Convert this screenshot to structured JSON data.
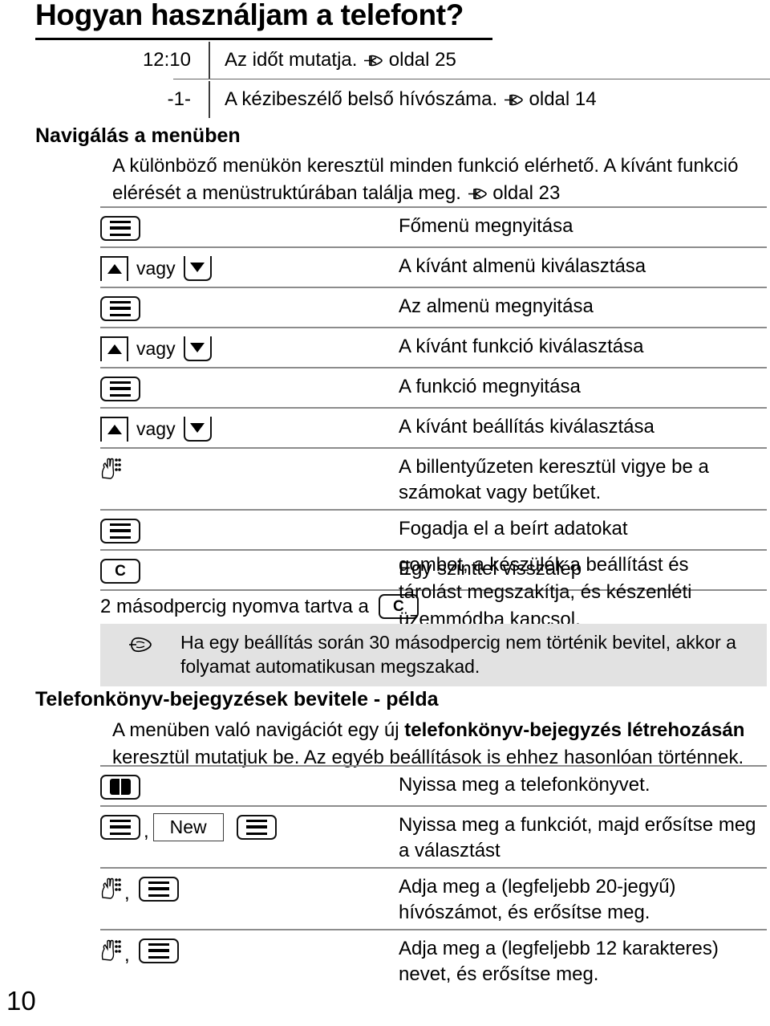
{
  "page": {
    "title": "Hogyan használjam a telefont?",
    "page_number": "10"
  },
  "display_table": {
    "rows": [
      {
        "symbol": "12:10",
        "description": "Az időt mutatja.",
        "ref_icon": "pointing-hand-icon",
        "ref": "oldal 25"
      },
      {
        "symbol": "-1-",
        "description": "A kézibeszélő belső hívószáma.",
        "ref_icon": "pointing-hand-icon",
        "ref": "oldal 14"
      }
    ]
  },
  "section_nav": {
    "heading": "Navigálás a menüben",
    "intro_part1": "A különböző menükön keresztül minden funkció elérhető. A kívánt funkció elérését a menüstruktúrában találja meg.",
    "intro_ref_icon": "pointing-hand-icon",
    "intro_ref": "oldal 23",
    "steps": [
      {
        "keys": [
          {
            "type": "menu-key"
          }
        ],
        "description": "Főmenü megnyitása"
      },
      {
        "keys": [
          {
            "type": "up-key"
          },
          {
            "type": "text",
            "value": "vagy"
          },
          {
            "type": "down-key"
          }
        ],
        "description": "A kívánt almenü kiválasztása"
      },
      {
        "keys": [
          {
            "type": "menu-key"
          }
        ],
        "description": "Az almenü megnyitása"
      },
      {
        "keys": [
          {
            "type": "up-key"
          },
          {
            "type": "text",
            "value": "vagy"
          },
          {
            "type": "down-key"
          }
        ],
        "description": "A kívánt funkció kiválasztása"
      },
      {
        "keys": [
          {
            "type": "menu-key"
          }
        ],
        "description": "A funkció megnyitása"
      },
      {
        "keys": [
          {
            "type": "up-key"
          },
          {
            "type": "text",
            "value": "vagy"
          },
          {
            "type": "down-key"
          }
        ],
        "description": "A kívánt beállítás kiválasztása"
      },
      {
        "keys": [
          {
            "type": "keypad-key"
          }
        ],
        "description": "A billentyűzeten keresztül vigye be a számokat vagy betűket."
      },
      {
        "keys": [
          {
            "type": "menu-key"
          }
        ],
        "description": "Fogadja el a beírt adatokat"
      },
      {
        "keys": [
          {
            "type": "c-key",
            "label": "C"
          }
        ],
        "description": "Egy szinttel visszalép"
      }
    ],
    "longpress": {
      "prefix": "2 másodpercig nyomva tartva a",
      "key_label": "C",
      "continuation": "gombot, a készülék a beállítást és tárolást megszakítja, és készenléti üzemmódba kapcsol."
    },
    "note": {
      "icon": "pointing-hand-icon",
      "text": "Ha egy beállítás során 30 másodpercig nem történik bevitel, akkor a folyamat automatikusan megszakad."
    }
  },
  "section_phonebook": {
    "heading": "Telefonkönyv-bejegyzések bevitele - példa",
    "intro_before_bold": "A menüben való navigációt egy új ",
    "intro_bold": "telefonkönyv-bejegyzés létrehozásán",
    "intro_after_bold": " keresztül mutatjuk be. Az egyéb beállítások is ehhez hasonlóan történnek.",
    "steps": [
      {
        "keys": [
          {
            "type": "book-key"
          }
        ],
        "description": "Nyissa meg a telefonkönyvet."
      },
      {
        "keys": [
          {
            "type": "menu-key"
          },
          {
            "type": "comma"
          },
          {
            "type": "label",
            "value": "New"
          },
          {
            "type": "menu-key"
          }
        ],
        "description": "Nyissa meg a funkciót, majd erősítse meg a választást"
      },
      {
        "keys": [
          {
            "type": "keypad-key"
          },
          {
            "type": "comma"
          },
          {
            "type": "menu-key"
          }
        ],
        "description": "Adja meg a (legfeljebb 20-jegyű) hívószámot, és erősítse meg."
      },
      {
        "keys": [
          {
            "type": "keypad-key"
          },
          {
            "type": "comma"
          },
          {
            "type": "menu-key"
          }
        ],
        "description": "Adja meg a (legfeljebb 12 karakteres) nevet, és erősítse meg."
      }
    ]
  },
  "colors": {
    "text": "#000000",
    "rule": "#8c8c8c",
    "note_background": "#e2e2e2",
    "key_border": "#111111"
  }
}
